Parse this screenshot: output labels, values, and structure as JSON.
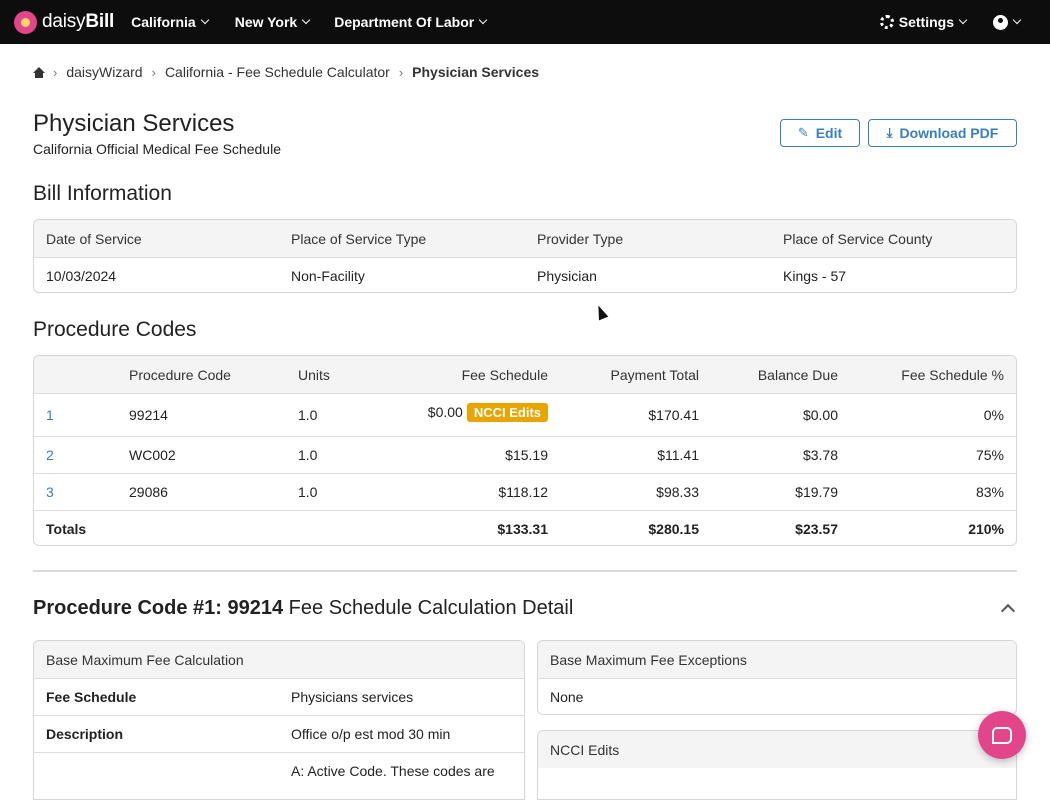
{
  "nav": {
    "logo_daisy": "daisy",
    "logo_bill": "Bill",
    "state": "California",
    "city": "New York",
    "agency": "Department Of Labor",
    "settings": "Settings"
  },
  "breadcrumb": [
    "daisyWizard",
    "California - Fee Schedule Calculator",
    "Physician Services"
  ],
  "page": {
    "title": "Physician Services",
    "subtitle": "California Official Medical Fee Schedule",
    "edit_label": "Edit",
    "download_label": "Download PDF"
  },
  "bill_info": {
    "heading": "Bill Information",
    "headers": [
      "Date of Service",
      "Place of Service Type",
      "Provider Type",
      "Place of Service County"
    ],
    "values": [
      "10/03/2024",
      "Non-Facility",
      "Physician",
      "Kings - 57"
    ]
  },
  "procedures": {
    "heading": "Procedure Codes",
    "headers": [
      "",
      "Procedure Code",
      "Units",
      "Fee Schedule",
      "Payment Total",
      "Balance Due",
      "Fee Schedule %"
    ],
    "rows": [
      {
        "num": "1",
        "code": "99214",
        "units": "1.0",
        "fee": "$0.00",
        "badge": "NCCI Edits",
        "payment": "$170.41",
        "balance": "$0.00",
        "pct": "0%"
      },
      {
        "num": "2",
        "code": "WC002",
        "units": "1.0",
        "fee": "$15.19",
        "badge": "",
        "payment": "$11.41",
        "balance": "$3.78",
        "pct": "75%"
      },
      {
        "num": "3",
        "code": "29086",
        "units": "1.0",
        "fee": "$118.12",
        "badge": "",
        "payment": "$98.33",
        "balance": "$19.79",
        "pct": "83%"
      }
    ],
    "totals": {
      "label": "Totals",
      "fee": "$133.31",
      "payment": "$280.15",
      "balance": "$23.57",
      "pct": "210%"
    }
  },
  "detail": {
    "title_bold": "Procedure Code #1: 99214",
    "title_rest": " Fee Schedule Calculation Detail",
    "base_card_title": "Base Maximum Fee Calculation",
    "base_rows": [
      {
        "label": "Fee Schedule",
        "value": "Physicians services"
      },
      {
        "label": "Description",
        "value": "Office o/p est mod 30 min"
      },
      {
        "label": "",
        "value": "A: Active Code. These codes are"
      }
    ],
    "exceptions_title": "Base Maximum Fee Exceptions",
    "exceptions_value": "None",
    "ncci_title": "NCCI Edits"
  }
}
